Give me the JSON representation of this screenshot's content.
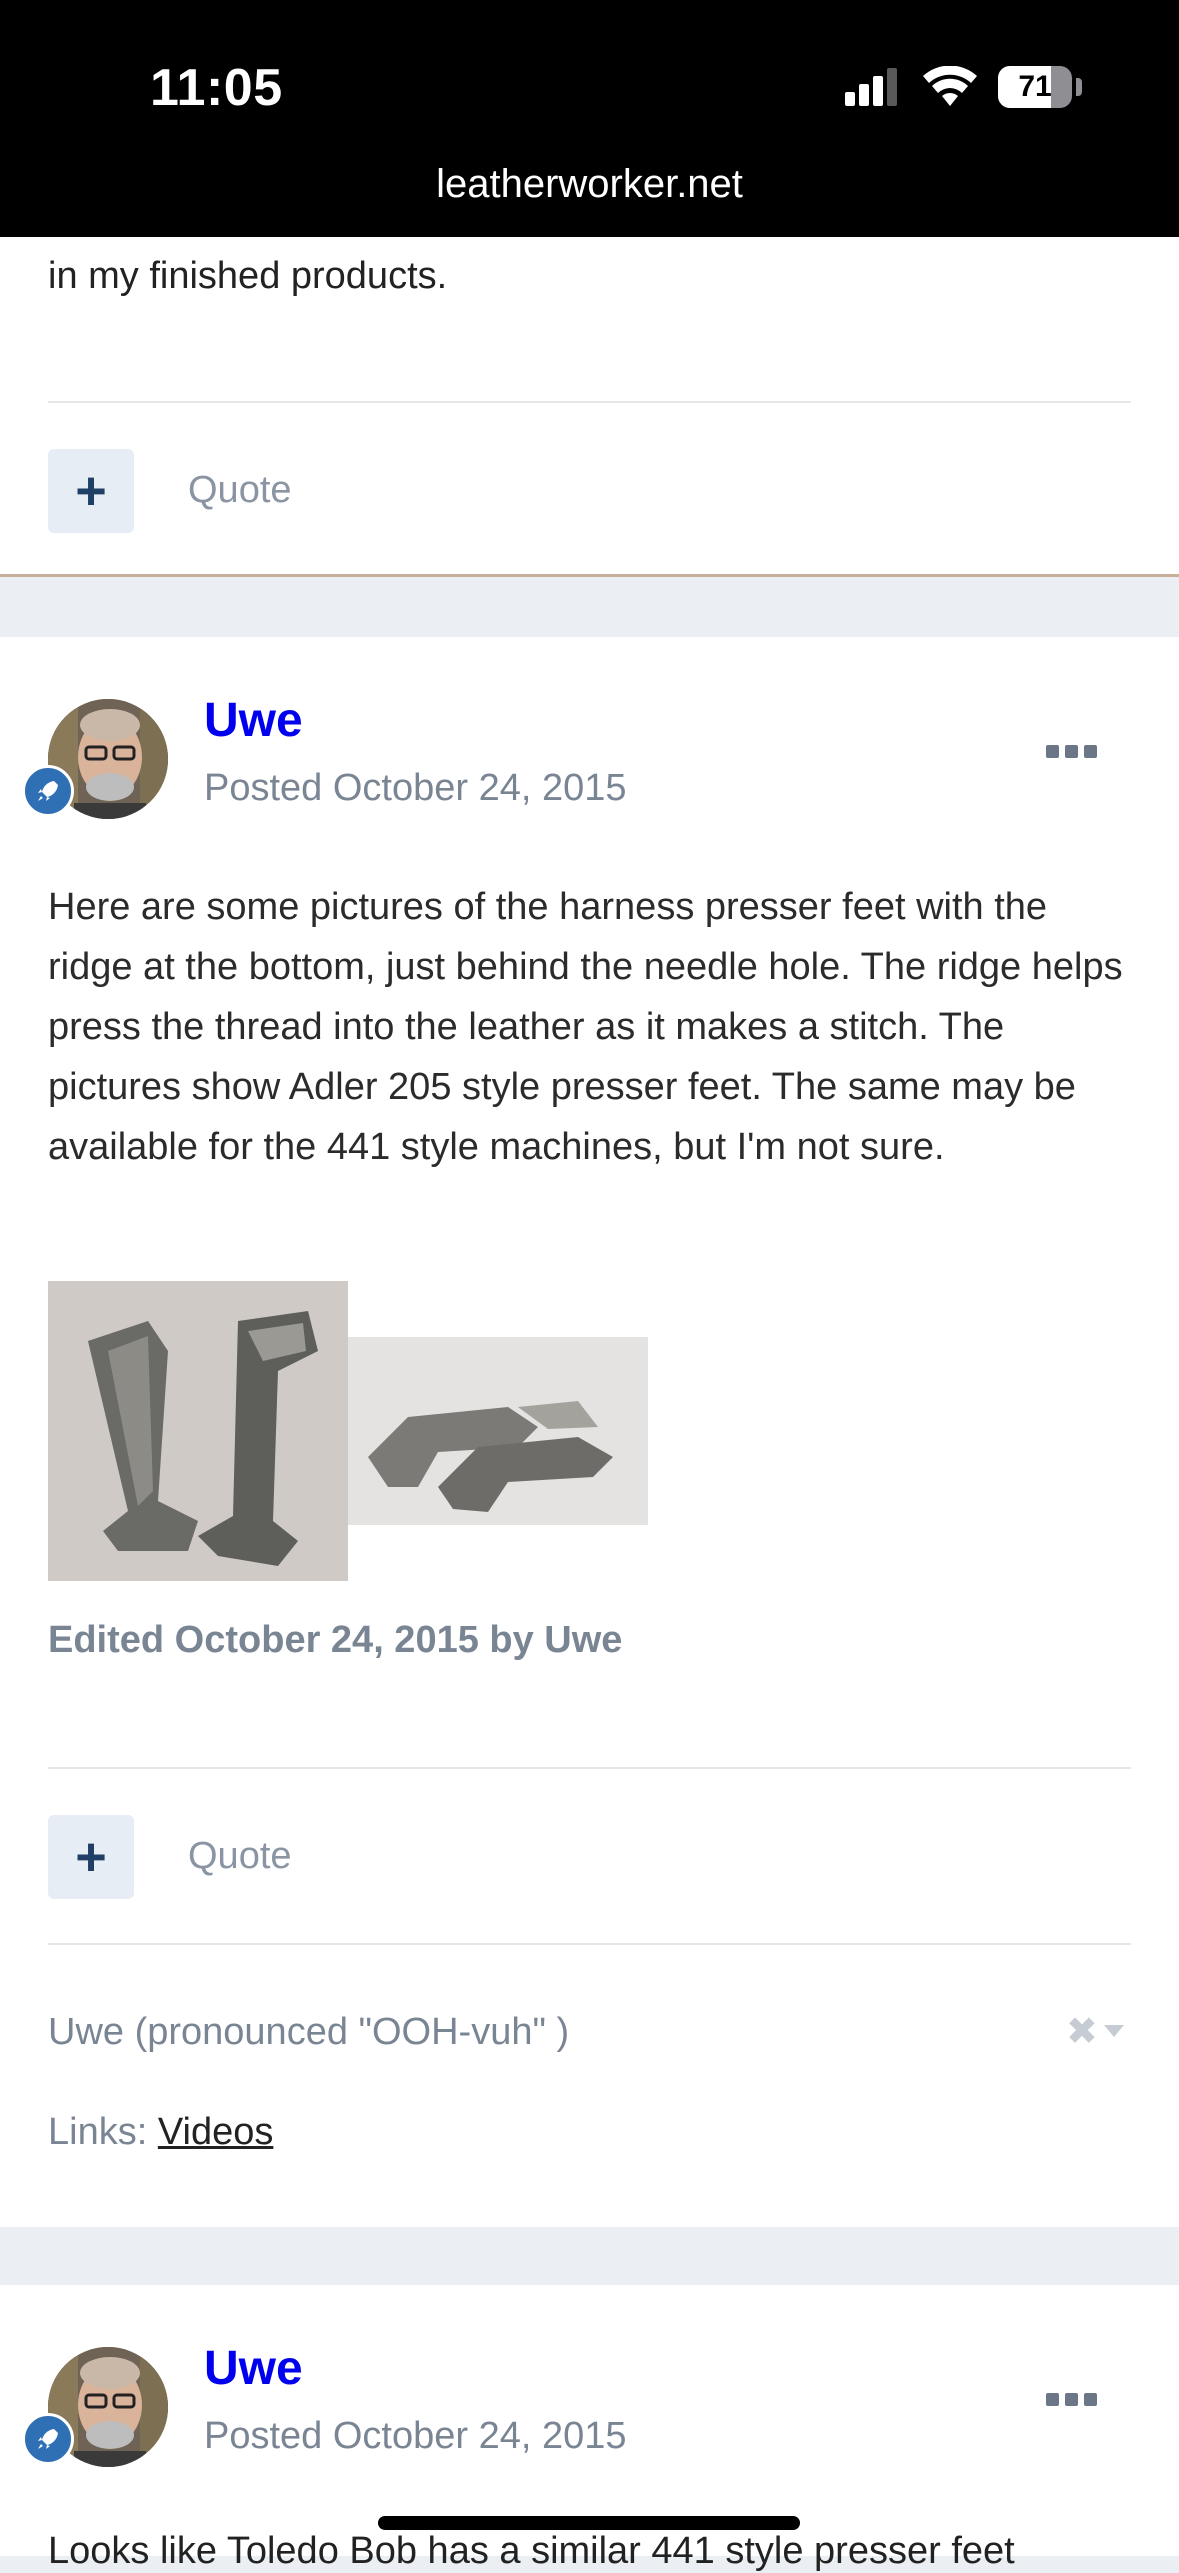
{
  "status_bar": {
    "time": "11:05",
    "battery": "71",
    "battery_level": 0.71,
    "url": "leatherworker.net"
  },
  "colors": {
    "author_link": "#0000ee",
    "muted_text": "#7a8594",
    "quote_button_bg": "#e6edf5",
    "badge_blue": "#2f6fb4"
  },
  "previous_post": {
    "clipped_line": "in my finished products.",
    "actions": {
      "plus_icon": "plus-icon",
      "quote_label": "Quote"
    }
  },
  "post": {
    "author": "Uwe",
    "posted": "Posted October 24, 2015",
    "body": "Here are some pictures of the harness presser feet with the ridge at the bottom, just behind the needle hole. The ridge helps press the thread into the leather as it makes a stitch. The pictures show Adler 205 style presser feet. The same may be available for the 441 style machines, but I'm not sure.",
    "edited": "Edited October 24, 2015 by Uwe",
    "actions": {
      "quote_label": "Quote"
    },
    "signature": {
      "name_line": "Uwe (pronounced \"OOH-vuh\" )",
      "links_label": "Links:",
      "links_value": "Videos"
    }
  },
  "next_post": {
    "author": "Uwe",
    "posted": "Posted October 24, 2015",
    "clipped_line": "Looks like Toledo Bob has a similar 441 style presser feet"
  }
}
